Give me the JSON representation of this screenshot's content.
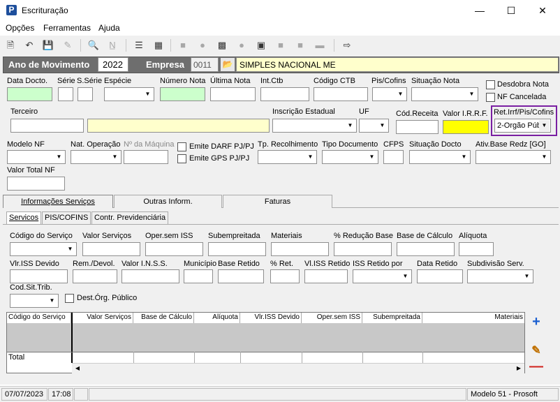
{
  "window": {
    "title": "Escrituração",
    "app_icon": "P"
  },
  "menu": [
    "Opções",
    "Ferramentas",
    "Ajuda"
  ],
  "header": {
    "ano_label": "Ano de Movimento",
    "ano_value": "2022",
    "empresa_label": "Empresa",
    "empresa_code": "0011",
    "empresa_name": "SIMPLES NACIONAL ME"
  },
  "row1": {
    "data_docto": "Data Docto.",
    "serie": "Série",
    "s_serie": "S.Série",
    "especie": "Espécie",
    "numero_nota": "Número Nota",
    "ultima_nota": "Última Nota",
    "int_ctb": "Int.Ctb",
    "codigo_ctb": "Código CTB",
    "pis_cofins": "Pis/Cofins",
    "situacao_nota": "Situação Nota",
    "desdobra_nota": "Desdobra Nota",
    "nf_cancelada": "NF Cancelada"
  },
  "row2": {
    "terceiro": "Terceiro",
    "inscricao_estadual": "Inscrição Estadual",
    "uf": "UF",
    "cod_receita": "Cód.Receita",
    "valor_irrf": "Valor I.R.R.F.",
    "ret_label": "Ret.Irrf/Pis/Cofins",
    "ret_value": "2-Orgão Púb"
  },
  "row3": {
    "modelo_nf": "Modelo NF",
    "nat_operacao": "Nat. Operação",
    "n_maquina": "Nº da Máquina",
    "emite_darf": "Emite DARF PJ/PJ",
    "emite_gps": "Emite GPS PJ/PJ",
    "tp_recolhimento": "Tp. Recolhimento",
    "tipo_documento": "Tipo Documento",
    "cfps": "CFPS",
    "situacao_docto": "Situação Docto",
    "ativ_base": "Ativ.Base Redz [GO]",
    "valor_total_nf": "Valor Total NF"
  },
  "tabs": [
    "Informações Serviços",
    "Outras Inform.",
    "Faturas"
  ],
  "subtabs": [
    "Servicos",
    "PIS/COFINS",
    "Contr. Previdenciária"
  ],
  "servicos": {
    "codigo_servico": "Código do Serviço",
    "valor_servicos": "Valor Serviços",
    "oper_sem_iss": "Oper.sem ISS",
    "subempreitada": "Subempreitada",
    "materiais": "Materiais",
    "reducao_base": "% Redução Base",
    "base_calculo": "Base de Cálculo",
    "aliquota": "Alíquota",
    "vlr_iss_devido": "Vlr.ISS Devido",
    "rem_devol": "Rem./Devol.",
    "valor_inss": "Valor I.N.S.S.",
    "municipio": "Município",
    "base_retido": "Base Retido",
    "pct_ret": "% Ret.",
    "vl_iss_retido": "Vl.ISS Retido",
    "iss_retido_por": "ISS Retido por",
    "data_retido": "Data Retido",
    "subdivisao": "Subdivisão Serv.",
    "cod_sit_trib": "Cod.Sit.Trib.",
    "dest_org": "Dest.Órg. Público"
  },
  "grid": {
    "columns": [
      "Código do Serviço",
      "Valor Serviços",
      "Base de Cálculo",
      "Alíquota",
      "Vlr.ISS Devido",
      "Oper.sem ISS",
      "Subempreitada",
      "Materiais"
    ],
    "total_label": "Total"
  },
  "status": {
    "date": "07/07/2023",
    "time": "17:08",
    "model": "Modelo 51 - Prosoft"
  }
}
